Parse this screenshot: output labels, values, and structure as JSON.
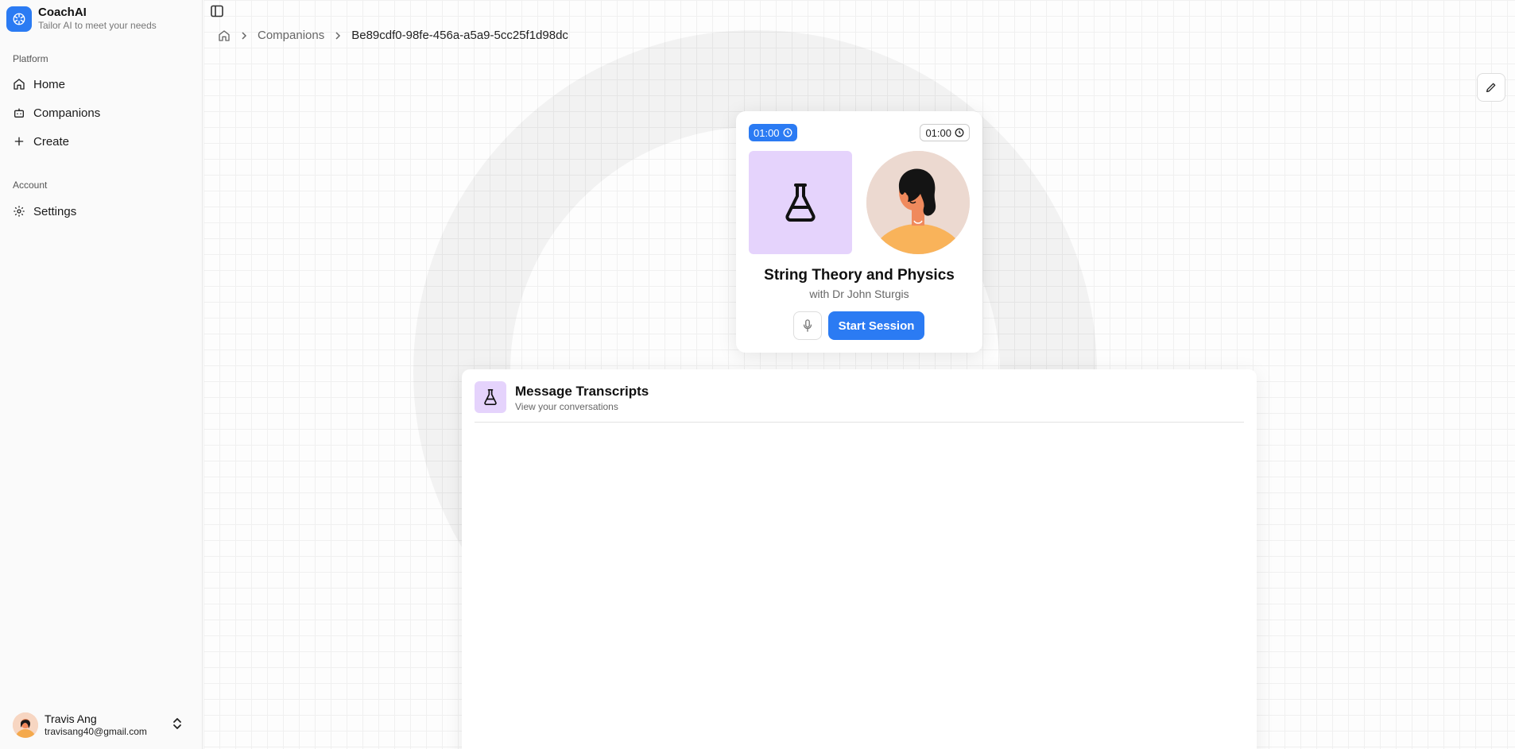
{
  "app": {
    "name": "CoachAI",
    "tagline": "Tailor AI to meet your needs"
  },
  "sidebar": {
    "platform_label": "Platform",
    "platform_items": [
      {
        "label": "Home",
        "icon": "home-icon"
      },
      {
        "label": "Companions",
        "icon": "bot-icon"
      },
      {
        "label": "Create",
        "icon": "plus-icon"
      }
    ],
    "account_label": "Account",
    "account_items": [
      {
        "label": "Settings",
        "icon": "gear-icon"
      }
    ]
  },
  "user": {
    "name": "Travis Ang",
    "email": "travisang40@gmail.com"
  },
  "breadcrumb": {
    "items": [
      "Companions",
      "Be89cdf0-98fe-456a-a5a9-5cc25f1d98dc"
    ]
  },
  "session": {
    "timer_elapsed": "01:00",
    "timer_total": "01:00",
    "title": "String Theory and Physics",
    "subtitle": "with Dr John Sturgis",
    "start_label": "Start Session"
  },
  "transcripts": {
    "title": "Message Transcripts",
    "subtitle": "View your conversations"
  },
  "colors": {
    "accent": "#2b7bf3",
    "subject_tile": "#e5d3fc",
    "avatar_bg": "#ecd9d0"
  }
}
